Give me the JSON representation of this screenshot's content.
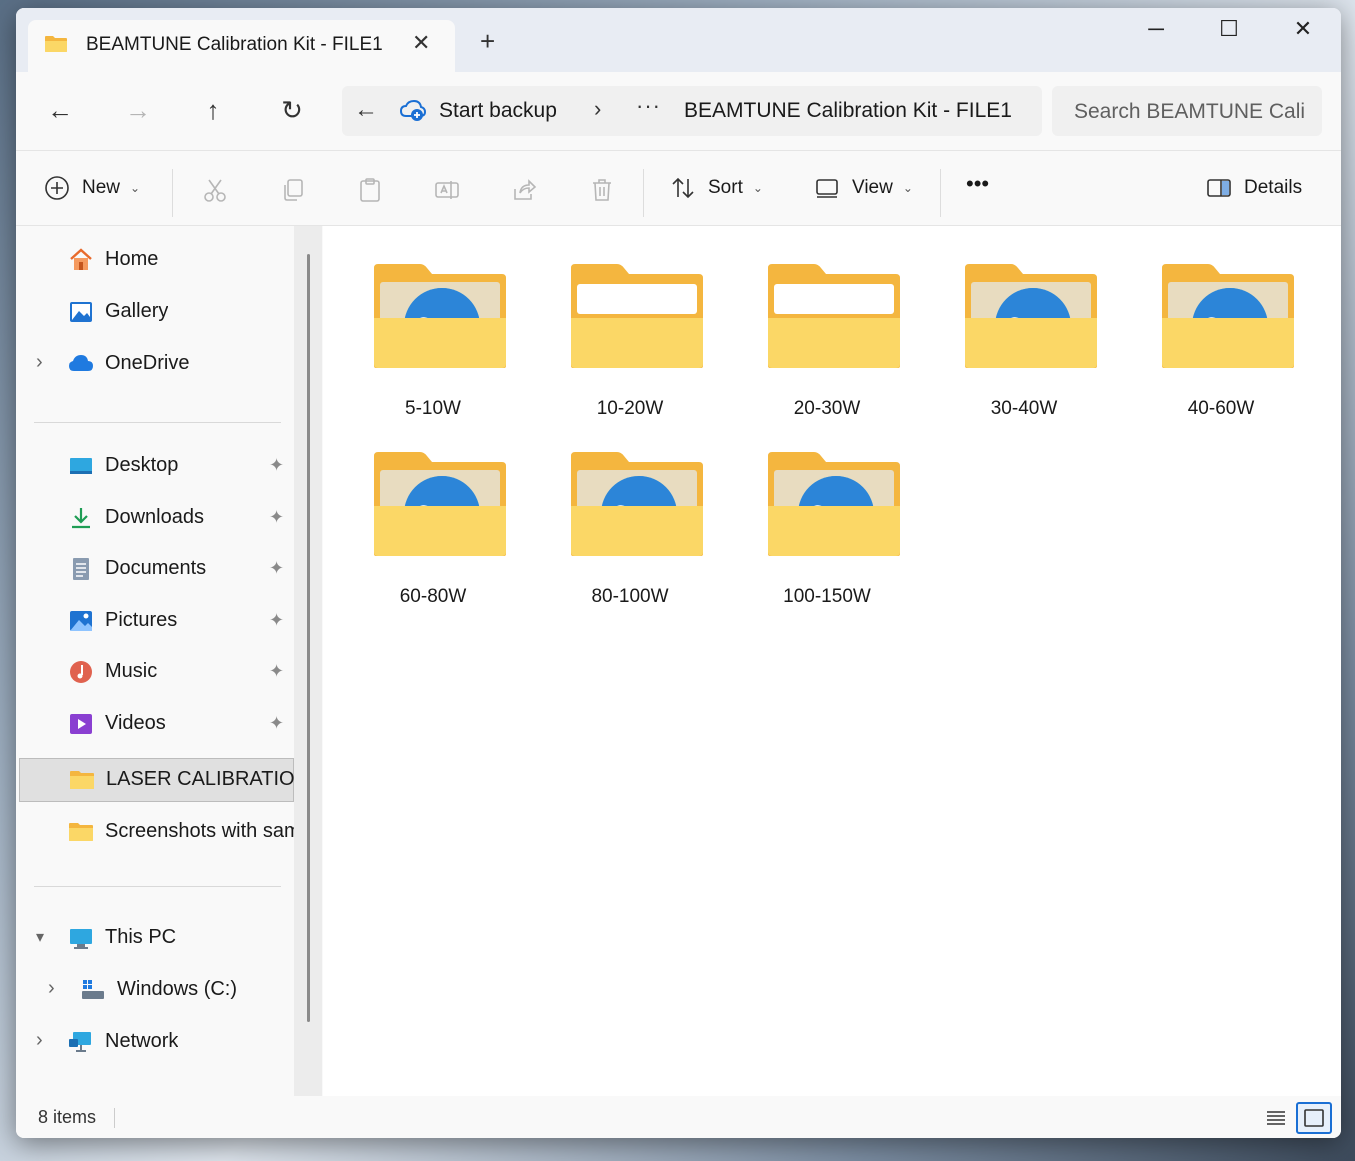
{
  "tab": {
    "title": "BEAMTUNE Calibration Kit - FILE1",
    "close": "✕",
    "new": "+"
  },
  "window_controls": {
    "minimize": "─",
    "maximize": "☐",
    "close": "✕"
  },
  "nav_buttons": {
    "back": "←",
    "forward": "→",
    "up": "↑",
    "refresh": "↻"
  },
  "address": {
    "back": "←",
    "backup_label": "Start backup",
    "chevron": "›",
    "dots": "···",
    "path": "BEAMTUNE Calibration Kit - FILE1"
  },
  "search": {
    "placeholder": "Search BEAMTUNE Cali"
  },
  "commands": {
    "new_label": "New",
    "sort_label": "Sort",
    "view_label": "View",
    "more_label": "•••",
    "details_label": "Details"
  },
  "nav": {
    "home": "Home",
    "gallery": "Gallery",
    "onedrive": "OneDrive",
    "desktop": "Desktop",
    "downloads": "Downloads",
    "documents": "Documents",
    "pictures": "Pictures",
    "music": "Music",
    "videos": "Videos",
    "laser": "LASER CALIBRATION KIT",
    "screenshots": "Screenshots with sample",
    "thispc": "This PC",
    "windows": "Windows (C:)",
    "network": "Network",
    "pin": "📌"
  },
  "folders": [
    {
      "name": "5-10W",
      "icon": "canva-folder"
    },
    {
      "name": "10-20W",
      "icon": "folder"
    },
    {
      "name": "20-30W",
      "icon": "folder"
    },
    {
      "name": "30-40W",
      "icon": "canva-folder"
    },
    {
      "name": "40-60W",
      "icon": "canva-folder"
    },
    {
      "name": "60-80W",
      "icon": "canva-folder"
    },
    {
      "name": "80-100W",
      "icon": "canva-folder"
    },
    {
      "name": "100-150W",
      "icon": "canva-folder"
    }
  ],
  "status": {
    "items": "8 items"
  },
  "colors": {
    "folder": "#f7c948",
    "folder_front": "#fbd766",
    "accent": "#1a6fd4",
    "canva": "#1bb3d8"
  }
}
